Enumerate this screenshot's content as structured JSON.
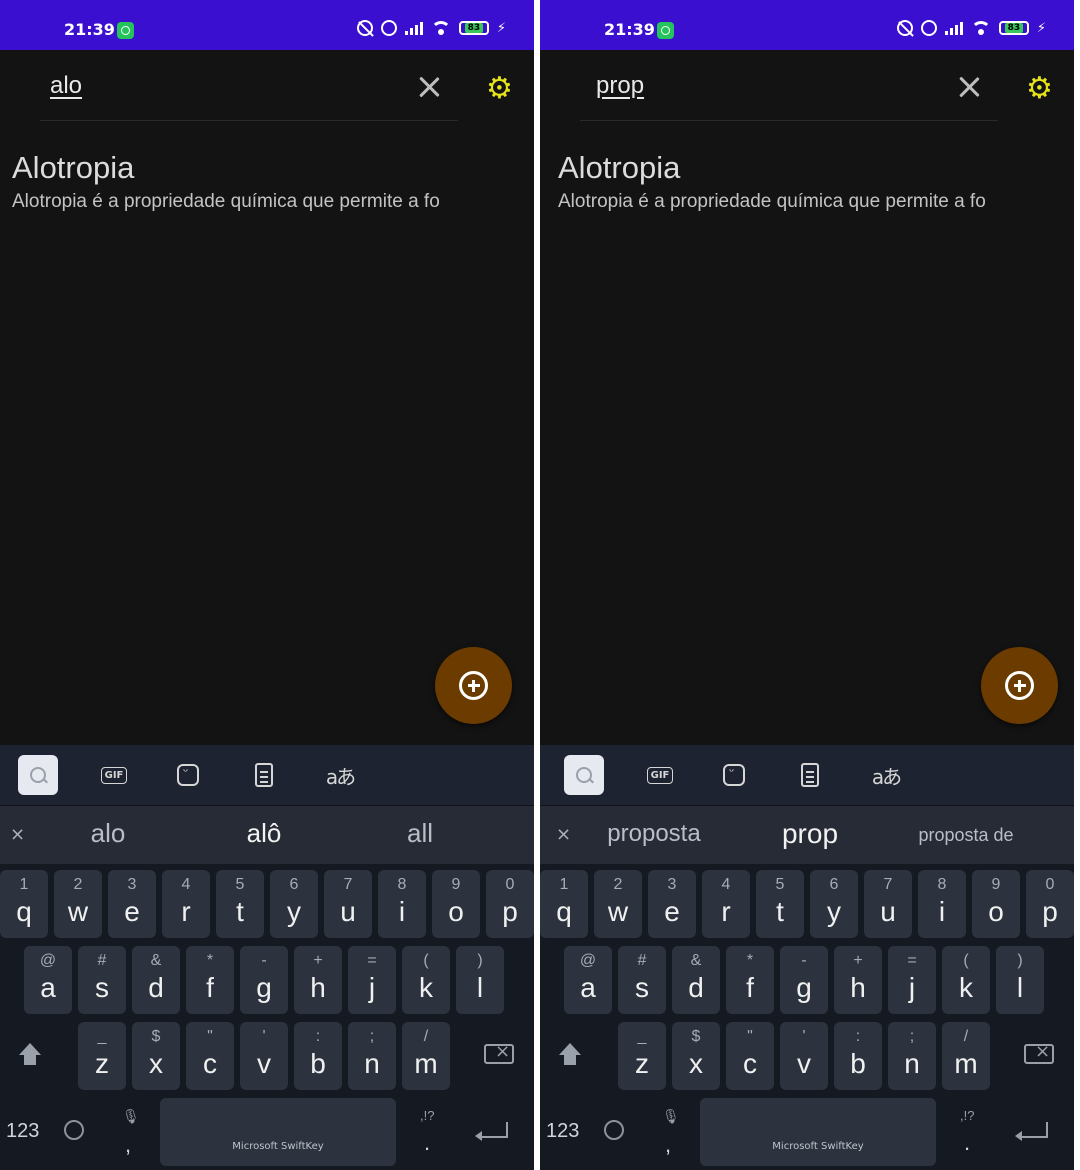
{
  "screens": [
    {
      "status": {
        "time": "21:39",
        "battery": "83"
      },
      "search": {
        "query": "alo"
      },
      "result": {
        "title": "Alotropia",
        "description": "Alotropia é a propriedade química que permite a fo"
      },
      "suggestions": [
        "alo",
        "alô",
        "all"
      ],
      "keyboard": {
        "brand": "Microsoft SwiftKey",
        "numbers_label": "123"
      }
    },
    {
      "status": {
        "time": "21:39",
        "battery": "83"
      },
      "search": {
        "query": "prop"
      },
      "result": {
        "title": "Alotropia",
        "description": "Alotropia é a propriedade química que permite a fo"
      },
      "suggestions": [
        "proposta",
        "prop",
        "proposta de"
      ],
      "keyboard": {
        "brand": "Microsoft SwiftKey",
        "numbers_label": "123"
      }
    }
  ],
  "keys": {
    "row1": [
      {
        "alt": "1",
        "main": "q"
      },
      {
        "alt": "2",
        "main": "w"
      },
      {
        "alt": "3",
        "main": "e"
      },
      {
        "alt": "4",
        "main": "r"
      },
      {
        "alt": "5",
        "main": "t"
      },
      {
        "alt": "6",
        "main": "y"
      },
      {
        "alt": "7",
        "main": "u"
      },
      {
        "alt": "8",
        "main": "i"
      },
      {
        "alt": "9",
        "main": "o"
      },
      {
        "alt": "0",
        "main": "p"
      }
    ],
    "row2": [
      {
        "alt": "@",
        "main": "a"
      },
      {
        "alt": "#",
        "main": "s"
      },
      {
        "alt": "&",
        "main": "d"
      },
      {
        "alt": "*",
        "main": "f"
      },
      {
        "alt": "-",
        "main": "g"
      },
      {
        "alt": "+",
        "main": "h"
      },
      {
        "alt": "=",
        "main": "j"
      },
      {
        "alt": "(",
        "main": "k"
      },
      {
        "alt": ")",
        "main": "l"
      }
    ],
    "row3": [
      {
        "alt": "_",
        "main": "z"
      },
      {
        "alt": "$",
        "main": "x"
      },
      {
        "alt": "\"",
        "main": "c"
      },
      {
        "alt": "'",
        "main": "v"
      },
      {
        "alt": ":",
        "main": "b"
      },
      {
        "alt": ";",
        "main": "n"
      },
      {
        "alt": "/",
        "main": "m"
      }
    ],
    "comma": ",",
    "period": ".",
    "punct_alt": ",!?"
  },
  "colors": {
    "status_bar": "#3a0fcf",
    "gear": "#e4e21a",
    "fab": "#6b3b00",
    "background": "#131313"
  }
}
